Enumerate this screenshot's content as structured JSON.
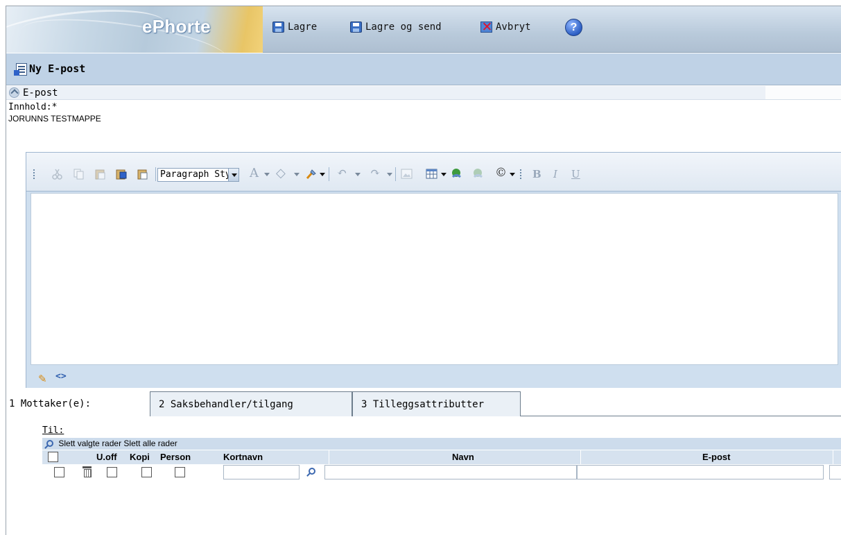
{
  "header": {
    "brand": "ePhorte",
    "save_label": "Lagre",
    "save_send_label": "Lagre og send",
    "cancel_label": "Avbryt"
  },
  "title": "Ny E-post",
  "section": "E-post",
  "content_label": "Innhold:*",
  "subject_value": "JORUNNS TESTMAPPE",
  "editor": {
    "paragraph_style": "Paragraph Sty"
  },
  "tabs": [
    {
      "label": "1 Mottaker(e):"
    },
    {
      "label": "2 Saksbehandler/tilgang"
    },
    {
      "label": "3 Tilleggsattributter"
    }
  ],
  "recipients": {
    "til_label": "Til:",
    "delete_selected": "Slett valgte rader",
    "delete_all": "Slett alle rader",
    "columns": [
      "U.off",
      "Kopi",
      "Person",
      "Kortnavn",
      "Navn",
      "E-post"
    ]
  },
  "colors": {
    "header_bg": "#b9cadb",
    "title_bg": "#bfd2e6",
    "editor_bg": "#cfdfef",
    "brand_accent": "#f2d27a"
  }
}
